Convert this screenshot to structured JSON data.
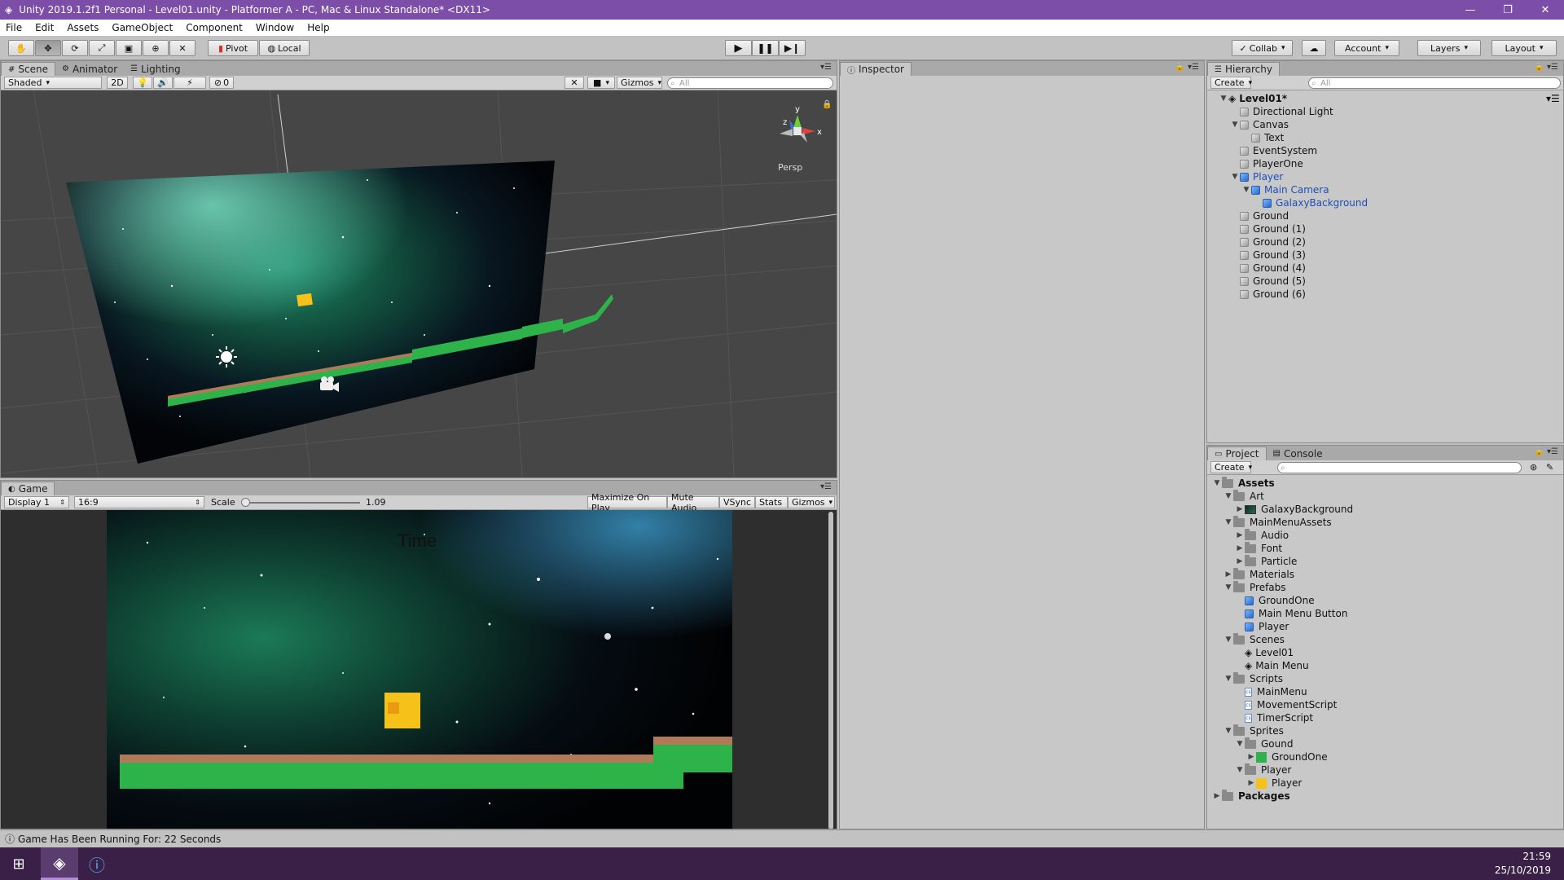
{
  "window": {
    "title": "Unity 2019.1.2f1 Personal - Level01.unity - Platformer A - PC, Mac & Linux Standalone* <DX11>",
    "controls": [
      "—",
      "❐",
      "✕"
    ]
  },
  "menu": [
    "File",
    "Edit",
    "Assets",
    "GameObject",
    "Component",
    "Window",
    "Help"
  ],
  "toolbar": {
    "pivot": "Pivot",
    "local": "Local",
    "collab": "Collab",
    "account": "Account",
    "layers": "Layers",
    "layout": "Layout"
  },
  "scene_panel": {
    "tabs": [
      "Scene",
      "Animator",
      "Lighting"
    ],
    "shading": "Shaded",
    "mode_2d": "2D",
    "counter": "0",
    "gizmos": "Gizmos",
    "search_placeholder": "All",
    "persp_label": "Persp",
    "axis_labels": {
      "y": "y",
      "z": "z",
      "x": "x"
    }
  },
  "game_panel": {
    "tab": "Game",
    "display": "Display 1",
    "aspect": "16:9",
    "scale_label": "Scale",
    "scale_value": "1.09",
    "scale_fraction": 0.03,
    "buttons": [
      "Maximize On Play",
      "Mute Audio",
      "VSync",
      "Stats",
      "Gizmos"
    ],
    "hud_text": "Time"
  },
  "inspector": {
    "tab": "Inspector"
  },
  "hierarchy": {
    "tab": "Hierarchy",
    "create": "Create",
    "search_placeholder": "All",
    "scene_name": "Level01*",
    "items": [
      {
        "label": "Directional Light",
        "depth": 1,
        "arrow": "",
        "blue": false
      },
      {
        "label": "Canvas",
        "depth": 1,
        "arrow": "▼",
        "blue": false
      },
      {
        "label": "Text",
        "depth": 2,
        "arrow": "",
        "blue": false
      },
      {
        "label": "EventSystem",
        "depth": 1,
        "arrow": "",
        "blue": false
      },
      {
        "label": "PlayerOne",
        "depth": 1,
        "arrow": "",
        "blue": false
      },
      {
        "label": "Player",
        "depth": 1,
        "arrow": "▼",
        "blue": true
      },
      {
        "label": "Main Camera",
        "depth": 2,
        "arrow": "▼",
        "blue": true
      },
      {
        "label": "GalaxyBackground",
        "depth": 3,
        "arrow": "",
        "blue": true
      },
      {
        "label": "Ground",
        "depth": 1,
        "arrow": "",
        "blue": false
      },
      {
        "label": "Ground (1)",
        "depth": 1,
        "arrow": "",
        "blue": false
      },
      {
        "label": "Ground (2)",
        "depth": 1,
        "arrow": "",
        "blue": false
      },
      {
        "label": "Ground (3)",
        "depth": 1,
        "arrow": "",
        "blue": false
      },
      {
        "label": "Ground (4)",
        "depth": 1,
        "arrow": "",
        "blue": false
      },
      {
        "label": "Ground (5)",
        "depth": 1,
        "arrow": "",
        "blue": false
      },
      {
        "label": "Ground (6)",
        "depth": 1,
        "arrow": "",
        "blue": false
      }
    ]
  },
  "project": {
    "tabs": [
      "Project",
      "Console"
    ],
    "create": "Create",
    "items": [
      {
        "label": "Assets",
        "depth": 0,
        "arrow": "▼",
        "icon": "folder",
        "bold": true
      },
      {
        "label": "Art",
        "depth": 1,
        "arrow": "▼",
        "icon": "folder"
      },
      {
        "label": "GalaxyBackground",
        "depth": 2,
        "arrow": "▶",
        "icon": "image"
      },
      {
        "label": "MainMenuAssets",
        "depth": 1,
        "arrow": "▼",
        "icon": "folder"
      },
      {
        "label": "Audio",
        "depth": 2,
        "arrow": "▶",
        "icon": "folder"
      },
      {
        "label": "Font",
        "depth": 2,
        "arrow": "▶",
        "icon": "folder"
      },
      {
        "label": "Particle",
        "depth": 2,
        "arrow": "▶",
        "icon": "folder"
      },
      {
        "label": "Materials",
        "depth": 1,
        "arrow": "▶",
        "icon": "folder"
      },
      {
        "label": "Prefabs",
        "depth": 1,
        "arrow": "▼",
        "icon": "folder"
      },
      {
        "label": "GroundOne",
        "depth": 2,
        "arrow": "",
        "icon": "prefab"
      },
      {
        "label": "Main Menu Button",
        "depth": 2,
        "arrow": "",
        "icon": "prefab"
      },
      {
        "label": "Player",
        "depth": 2,
        "arrow": "",
        "icon": "prefab"
      },
      {
        "label": "Scenes",
        "depth": 1,
        "arrow": "▼",
        "icon": "folder"
      },
      {
        "label": "Level01",
        "depth": 2,
        "arrow": "",
        "icon": "scene"
      },
      {
        "label": "Main Menu",
        "depth": 2,
        "arrow": "",
        "icon": "scene"
      },
      {
        "label": "Scripts",
        "depth": 1,
        "arrow": "▼",
        "icon": "folder"
      },
      {
        "label": "MainMenu",
        "depth": 2,
        "arrow": "",
        "icon": "script"
      },
      {
        "label": "MovementScript",
        "depth": 2,
        "arrow": "",
        "icon": "script"
      },
      {
        "label": "TimerScript",
        "depth": 2,
        "arrow": "",
        "icon": "script"
      },
      {
        "label": "Sprites",
        "depth": 1,
        "arrow": "▼",
        "icon": "folder"
      },
      {
        "label": "Gound",
        "depth": 2,
        "arrow": "▼",
        "icon": "folder"
      },
      {
        "label": "GroundOne",
        "depth": 3,
        "arrow": "▶",
        "icon": "sprite-green"
      },
      {
        "label": "Player",
        "depth": 2,
        "arrow": "▼",
        "icon": "folder"
      },
      {
        "label": "Player",
        "depth": 3,
        "arrow": "▶",
        "icon": "sprite-yellow"
      },
      {
        "label": "Packages",
        "depth": 0,
        "arrow": "▶",
        "icon": "folder",
        "bold": true
      }
    ]
  },
  "status": {
    "message": "Game Has Been Running For: 22 Seconds"
  },
  "taskbar": {
    "time": "21:59",
    "date": "25/10/2019"
  },
  "colors": {
    "title_bar": "#7d4ea8",
    "taskbar": "#3a2046",
    "ground_green": "#2db34a",
    "ground_brown": "#b07a5a",
    "player_yellow": "#f6c21a",
    "selection_blue": "#1e4fb5"
  }
}
